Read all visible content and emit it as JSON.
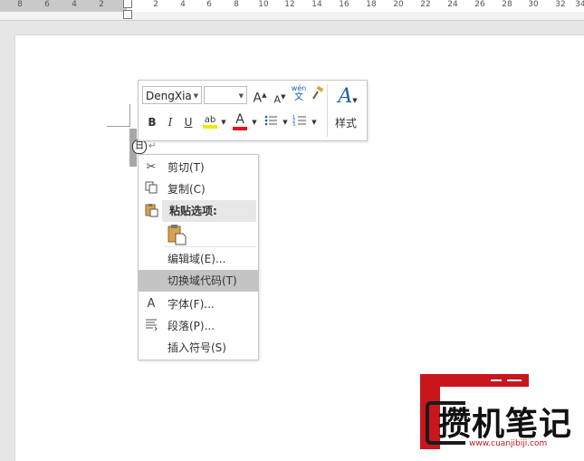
{
  "ruler": {
    "numbers": [
      "8",
      "6",
      "4",
      "2",
      "2",
      "4",
      "6",
      "8",
      "10",
      "12",
      "14",
      "16",
      "18",
      "20",
      "22",
      "24",
      "26",
      "28",
      "30",
      "32",
      "34"
    ]
  },
  "mini_toolbar": {
    "font_name": "DengXia",
    "font_size": "",
    "grow_font": "A",
    "shrink_font": "A",
    "phonetic_top": "wén",
    "phonetic_bottom": "文",
    "bold": "B",
    "italic": "I",
    "underline": "U",
    "highlight_glyph": "ab",
    "font_color_glyph": "A",
    "styles_glyph": "A",
    "styles_label": "样式",
    "highlight_color": "#f5e600",
    "font_color": "#e0141e"
  },
  "context_menu": {
    "items": [
      {
        "label": "剪切(T)",
        "icon": "scissors-icon"
      },
      {
        "label": "复制(C)",
        "icon": "copy-icon"
      },
      {
        "label": "粘贴选项:",
        "icon": "paste-icon"
      },
      {
        "label": "",
        "icon": "paste-keep-text-icon"
      },
      {
        "label": "编辑域(E)...",
        "icon": ""
      },
      {
        "label": "切换域代码(T)",
        "icon": ""
      },
      {
        "label": "字体(F)...",
        "icon": "font-icon"
      },
      {
        "label": "段落(P)...",
        "icon": "paragraph-icon"
      },
      {
        "label": "插入符号(S)",
        "icon": ""
      }
    ]
  },
  "document": {
    "field_symbol": "日",
    "paragraph_mark": "↵"
  },
  "watermark": {
    "title": "攒机笔记",
    "url": "www.cuanjibiji.com",
    "brand_color": "#c8161d"
  }
}
